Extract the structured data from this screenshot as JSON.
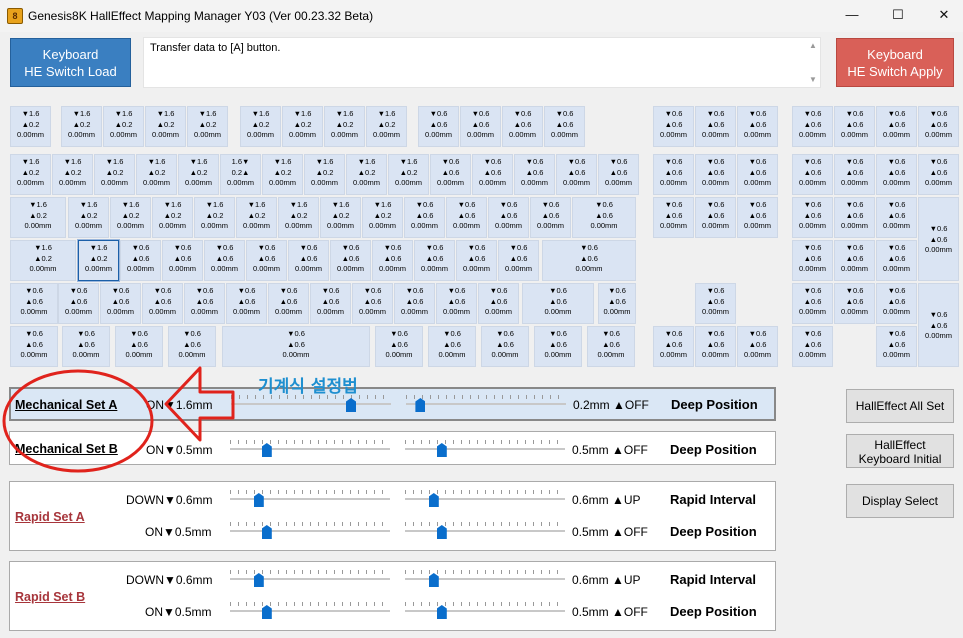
{
  "window": {
    "title": "Genesis8K HallEffect Mapping Manager Y03 (Ver 00.23.32 Beta)",
    "icon": "app-logo-icon",
    "controls": {
      "minimize": "—",
      "maximize": "☐",
      "close": "✕"
    }
  },
  "toolbar": {
    "load_label_1": "Keyboard",
    "load_label_2": "HE Switch Load",
    "apply_label_1": "Keyboard",
    "apply_label_2": "HE Switch Apply",
    "message": "Transfer data to [A] button."
  },
  "key_values": {
    "a": {
      "l1": "▼1.6",
      "l2": "▲0.2",
      "l3": "0.00mm"
    },
    "b": {
      "l1": "▼0.6",
      "l2": "▲0.6",
      "l3": "0.00mm"
    },
    "c": {
      "l1": "1.6▼",
      "l2": "0.2▲",
      "l3": "0.00mm"
    }
  },
  "panels": {
    "mech_a": {
      "name": "Mechanical Set A",
      "on": "ON▼1.6mm",
      "off": "0.2mm ▲OFF",
      "mode": "Deep Position",
      "press_level": 0.75,
      "release_level": 0.09
    },
    "mech_b": {
      "name": "Mechanical Set B",
      "on": "ON▼0.5mm",
      "off": "0.5mm ▲OFF",
      "mode": "Deep Position",
      "press_level": 0.23,
      "release_level": 0.23
    },
    "rapid_a": {
      "name": "Rapid Set A",
      "down": "DOWN▼0.6mm",
      "up": "0.6mm ▲UP",
      "interval": "Rapid Interval",
      "on": "ON▼0.5mm",
      "off": "0.5mm ▲OFF",
      "mode": "Deep  Position",
      "down_level": 0.18,
      "up_level": 0.18,
      "on_level": 0.23,
      "off_level": 0.23
    },
    "rapid_b": {
      "name": "Rapid Set B",
      "down": "DOWN▼0.6mm",
      "up": "0.6mm ▲UP",
      "interval": "Rapid Interval",
      "on": "ON▼0.5mm",
      "off": "0.5mm ▲OFF",
      "mode": "Deep  Position",
      "down_level": 0.18,
      "up_level": 0.18,
      "on_level": 0.23,
      "off_level": 0.23
    }
  },
  "side_buttons": {
    "all_set": "HallEffect All Set",
    "init_1": "HallEffect",
    "init_2": "Keyboard Initial",
    "display": "Display Select"
  },
  "annotation": {
    "text": "기계식 설정법",
    "color": "#e0231c"
  }
}
